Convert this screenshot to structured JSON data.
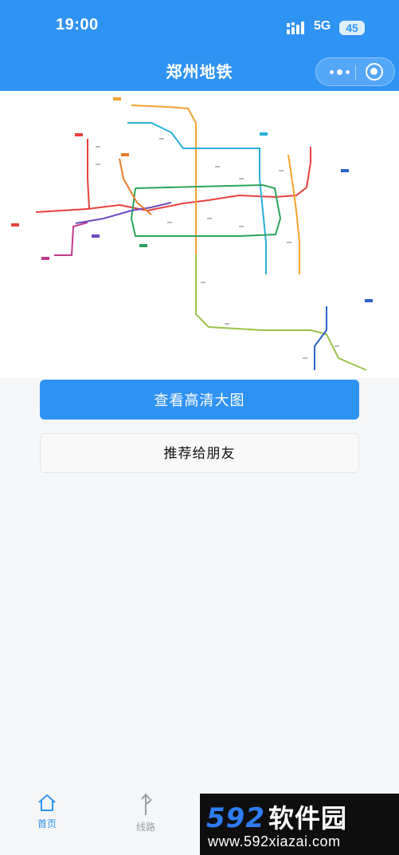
{
  "status_bar": {
    "time": "19:00",
    "network": "5G",
    "battery": "45"
  },
  "nav": {
    "title": "郑州地铁"
  },
  "actions": {
    "primary_label": "查看高清大图",
    "secondary_label": "推荐给朋友"
  },
  "tabbar": {
    "items": [
      {
        "label": "首页",
        "icon": "home-icon"
      },
      {
        "label": "线路",
        "icon": "route-icon"
      }
    ]
  },
  "watermark": {
    "brand": "592",
    "brand_cn": "软件园",
    "url": "www.592xiazai.com"
  },
  "colors": {
    "primary": "#2f93f4",
    "tab_active": "#2f93f4",
    "tab_inactive": "#9a9ea6"
  },
  "map_lines": [
    {
      "color": "#e8413c"
    },
    {
      "color": "#f4a12d"
    },
    {
      "color": "#27b0d8"
    },
    {
      "color": "#2ba35a"
    },
    {
      "color": "#c23a8f"
    },
    {
      "color": "#6b4bc1"
    },
    {
      "color": "#9bc34a"
    },
    {
      "color": "#2a62c9"
    },
    {
      "color": "#e87b2c"
    }
  ]
}
